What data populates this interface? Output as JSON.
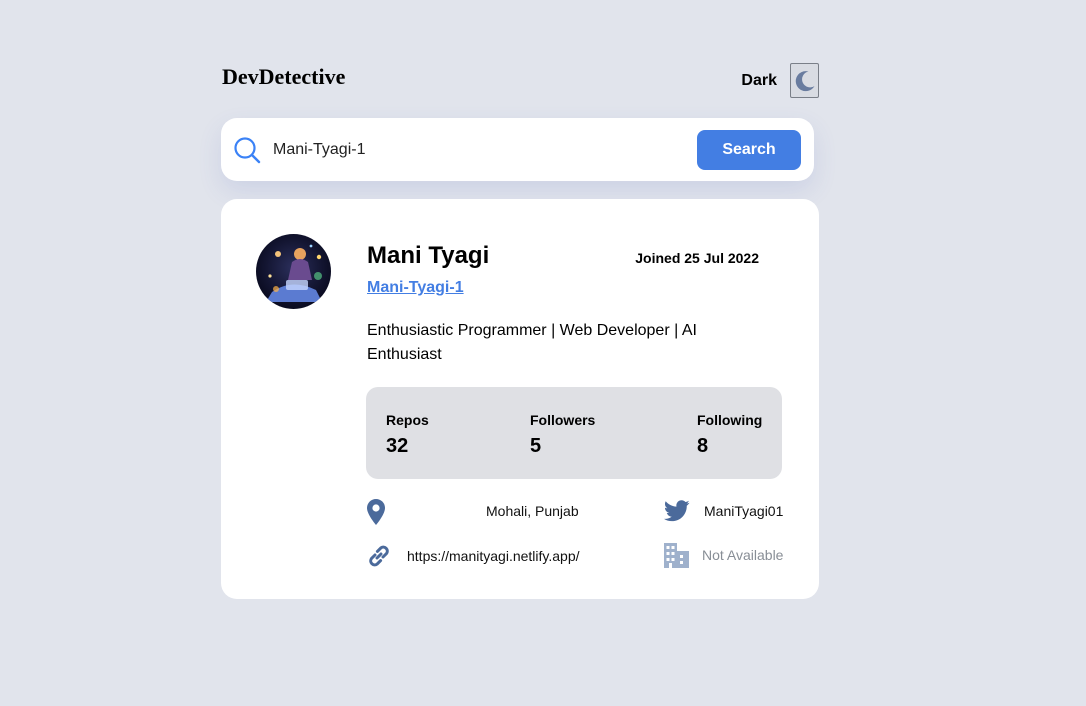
{
  "header": {
    "logo": "DevDetective",
    "mode_label": "Dark",
    "mode_icon": "moon-icon"
  },
  "search": {
    "value": "Mani-Tyagi-1",
    "button_label": "Search",
    "icon": "search-icon"
  },
  "profile": {
    "name": "Mani Tyagi",
    "joined": "Joined 25 Jul 2022",
    "username": "Mani-Tyagi-1",
    "bio": "Enthusiastic Programmer | Web Developer | AI Enthusiast",
    "stats": {
      "repos_label": "Repos",
      "repos_value": "32",
      "followers_label": "Followers",
      "followers_value": "5",
      "following_label": "Following",
      "following_value": "8"
    },
    "info": {
      "location": "Mohali, Punjab",
      "twitter": "ManiTyagi01",
      "website": "https://manityagi.netlify.app/",
      "company": "Not Available"
    }
  },
  "colors": {
    "background": "#e1e4ec",
    "accent": "#437ee3",
    "icon": "#4b6a9b",
    "muted_icon": "#9fb1cc"
  }
}
